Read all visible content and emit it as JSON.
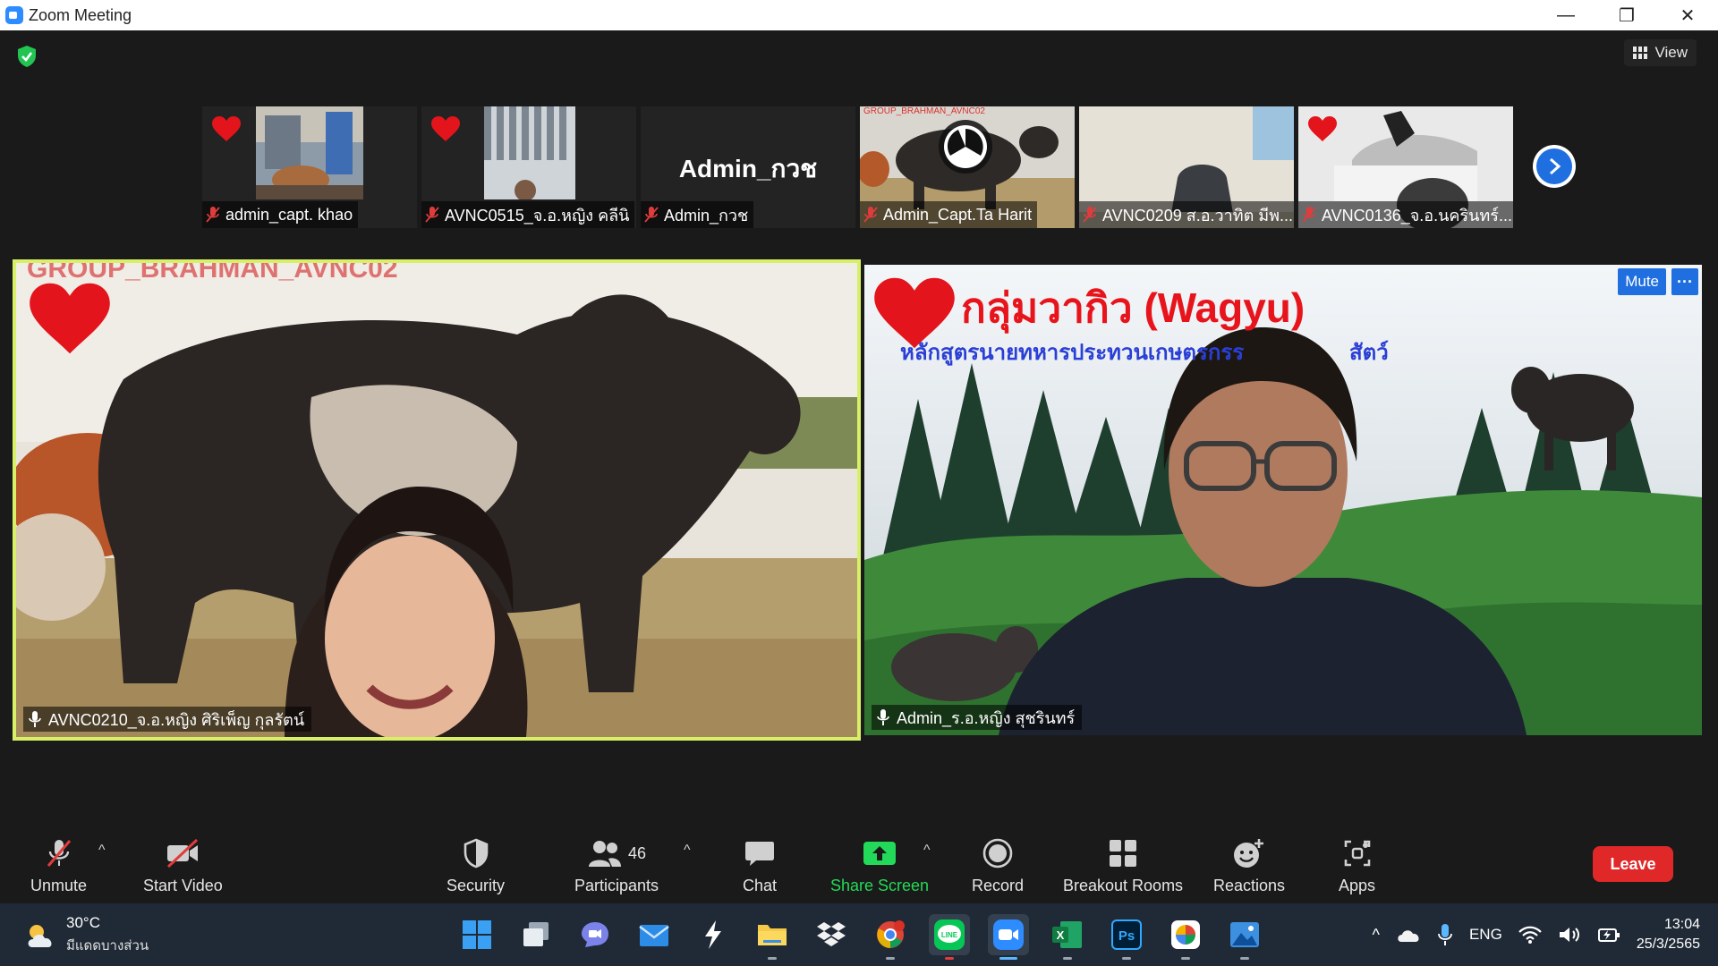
{
  "window": {
    "title": "Zoom Meeting",
    "minimize": "—",
    "restore": "❐",
    "close": "✕"
  },
  "top_bar": {
    "view_label": "View"
  },
  "thumbnails": [
    {
      "name": "admin_capt. khao",
      "heart": true
    },
    {
      "name": "AVNC0515_จ.อ.หญิง คลีนิ",
      "heart": true
    },
    {
      "name": "Admin_กวช",
      "display": "Admin_กวช",
      "heart": false
    },
    {
      "name": "Admin_Capt.Ta Harit",
      "heart": false,
      "overlay": "GROUP_BRAHMAN_AVNC02"
    },
    {
      "name": "AVNC0209 ส.อ.วาทิต มีพ...",
      "heart": false
    },
    {
      "name": "AVNC0136_จ.อ.นครินทร์...",
      "heart": true
    }
  ],
  "tiles": {
    "left": {
      "name": "AVNC0210_จ.อ.หญิง ศิริเพ็ญ กุลรัตน์",
      "overlay": "GROUP_BRAHMAN_AVNC02"
    },
    "right": {
      "name": "Admin_ร.อ.หญิง สุชรินทร์",
      "title": "กลุ่มวากิว (Wagyu)",
      "subtitle": "หลักสูตรนายทหารประทวนเกษตรกรร",
      "subtitle_end": "สัตว์",
      "mute_label": "Mute",
      "more_label": "···"
    }
  },
  "toolbar": {
    "unmute": "Unmute",
    "start_video": "Start Video",
    "security": "Security",
    "participants": "Participants",
    "participants_count": "46",
    "chat": "Chat",
    "share_screen": "Share Screen",
    "record": "Record",
    "breakout_rooms": "Breakout Rooms",
    "reactions": "Reactions",
    "apps": "Apps",
    "leave": "Leave",
    "caret": "^"
  },
  "taskbar": {
    "temperature": "30°C",
    "weather_desc": "มีแดดบางส่วน",
    "language": "ENG",
    "time": "13:04",
    "date": "25/3/2565",
    "line_label": "LINE",
    "excel_label": "X",
    "ps_label": "Ps",
    "caret": "^"
  },
  "colors": {
    "accent_blue": "#1f6fe0",
    "share_green": "#23d959",
    "leave_red": "#e02828",
    "active_speaker": "#d7f067",
    "heart_red": "#e3141b",
    "title_red": "#e8141c",
    "subtitle_blue": "#2a3fd6"
  }
}
